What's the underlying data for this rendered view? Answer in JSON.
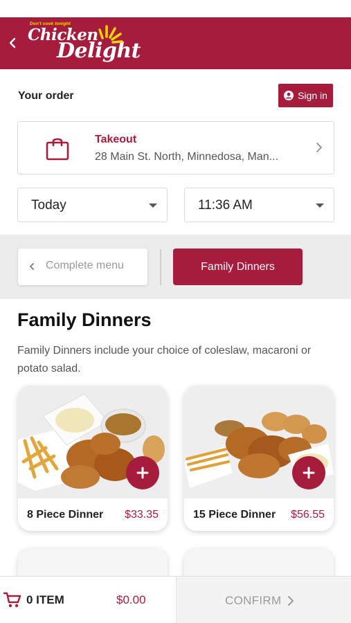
{
  "header": {
    "logo_tagline": "Don't cook tonight",
    "logo_word1": "Chicken",
    "logo_word2": "Delight"
  },
  "order": {
    "title": "Your order",
    "sign_in_label": "Sign in"
  },
  "pickup": {
    "mode": "Takeout",
    "address": "28 Main St. North, Minnedosa, Man..."
  },
  "schedule": {
    "day": "Today",
    "time": "11:36 AM"
  },
  "categories": {
    "back_label": "Complete menu",
    "active_label": "Family Dinners"
  },
  "section": {
    "title": "Family Dinners",
    "description": "Family Dinners include your choice of coleslaw, macaroni or potato salad."
  },
  "products": [
    {
      "name": "8 Piece Dinner",
      "price": "$33.35"
    },
    {
      "name": "15 Piece Dinner",
      "price": "$56.55"
    }
  ],
  "cart": {
    "items_label": "0 ITEM",
    "total": "$0.00",
    "confirm_label": "CONFIRM"
  },
  "colors": {
    "brand": "#a61c3c",
    "accent_yellow": "#ffd400"
  }
}
